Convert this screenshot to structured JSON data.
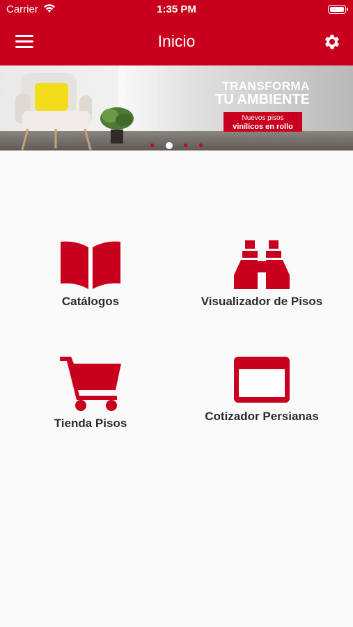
{
  "status_bar": {
    "carrier": "Carrier",
    "time": "1:35 PM"
  },
  "header": {
    "title": "Inicio"
  },
  "banner": {
    "headline_line1": "TRANSFORMA",
    "headline_line2": "TU AMBIENTE",
    "tag_line1": "Nuevos pisos",
    "tag_line2": "vinílicos en rollo",
    "slide_count": 4,
    "active_slide": 2
  },
  "tiles": [
    {
      "label": "Catálogos",
      "icon": "open-book-icon"
    },
    {
      "label": "Visualizador de Pisos",
      "icon": "binoculars-icon"
    },
    {
      "label": "Tienda Pisos",
      "icon": "shopping-cart-icon"
    },
    {
      "label": "Cotizador Persianas",
      "icon": "window-icon"
    }
  ],
  "colors": {
    "brand_red": "#c8001e",
    "background": "#fafafa",
    "label_text": "#2b2b2b"
  }
}
